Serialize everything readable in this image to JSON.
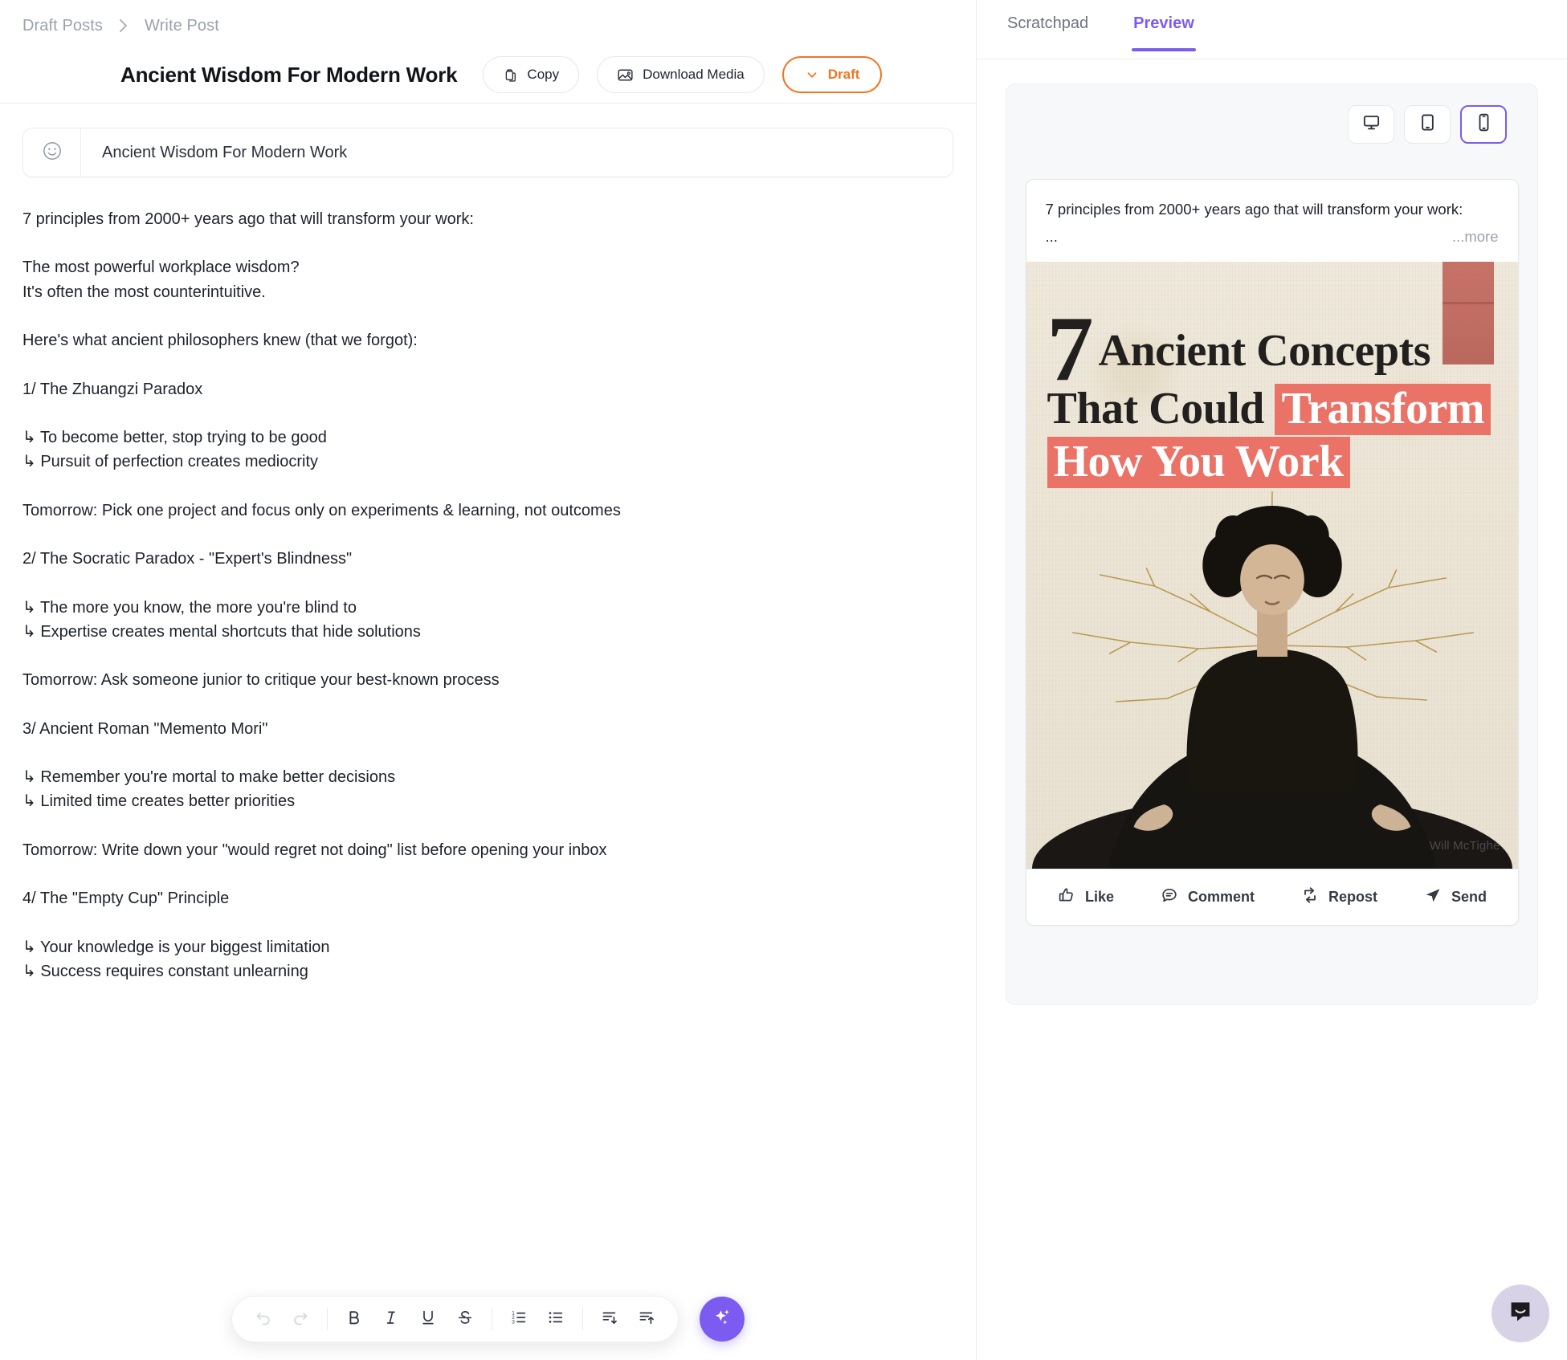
{
  "breadcrumb": {
    "parent": "Draft Posts",
    "current": "Write Post",
    "separator_icon": "chevron-right-icon"
  },
  "header": {
    "doc_title": "Ancient Wisdom For Modern Work",
    "copy_label": "Copy",
    "copy_icon": "clipboard-icon",
    "download_label": "Download Media",
    "download_icon": "image-icon",
    "draft_label": "Draft",
    "draft_icon": "chevron-down-icon",
    "draft_color": "#ef7622"
  },
  "title_field": {
    "emoji_icon": "smiley-icon",
    "value": "Ancient Wisdom For Modern Work",
    "placeholder": "Ancient Wisdom For Modern Work"
  },
  "post_body": {
    "paragraphs": [
      {
        "text": "7 principles from 2000+ years ago that will transform your work:",
        "style": "block"
      },
      {
        "text": "The most powerful workplace wisdom?",
        "style": "tight"
      },
      {
        "text": "It's often the most counterintuitive.",
        "style": "block"
      },
      {
        "text": "Here's what ancient philosophers knew (that we forgot):",
        "style": "block"
      },
      {
        "text": "1/ The Zhuangzi Paradox",
        "style": "block"
      },
      {
        "text": "↳ To become better, stop trying to be good",
        "style": "tight"
      },
      {
        "text": "↳ Pursuit of perfection creates mediocrity",
        "style": "block"
      },
      {
        "text": "Tomorrow: Pick one project and focus only on experiments & learning, not outcomes",
        "style": "block"
      },
      {
        "text": "2/ The Socratic Paradox - \"Expert's Blindness\"",
        "style": "block"
      },
      {
        "text": "↳ The more you know, the more you're blind to",
        "style": "tight"
      },
      {
        "text": "↳ Expertise creates mental shortcuts that hide solutions",
        "style": "block"
      },
      {
        "text": "Tomorrow: Ask someone junior to critique your best-known process",
        "style": "block"
      },
      {
        "text": "3/ Ancient Roman \"Memento Mori\"",
        "style": "block"
      },
      {
        "text": "↳ Remember you're mortal to make better decisions",
        "style": "tight"
      },
      {
        "text": "↳ Limited time creates better priorities",
        "style": "block"
      },
      {
        "text": "Tomorrow: Write down your \"would regret not doing\" list before opening your inbox",
        "style": "block"
      },
      {
        "text": "4/ The \"Empty Cup\" Principle",
        "style": "block"
      },
      {
        "text": "↳ Your knowledge is your biggest limitation",
        "style": "tight"
      },
      {
        "text": "↳ Success requires constant unlearning",
        "style": "block"
      }
    ]
  },
  "toolbar": {
    "buttons": [
      {
        "name": "undo-icon",
        "label": "Undo",
        "disabled": true
      },
      {
        "name": "redo-icon",
        "label": "Redo",
        "disabled": true
      },
      {
        "name": "bold-icon",
        "label": "B",
        "disabled": false
      },
      {
        "name": "italic-icon",
        "label": "I",
        "disabled": false
      },
      {
        "name": "underline-icon",
        "label": "U",
        "disabled": false
      },
      {
        "name": "strikethrough-icon",
        "label": "S",
        "disabled": false
      },
      {
        "name": "numbered-list-icon",
        "label": "Numbered list",
        "disabled": false
      },
      {
        "name": "bullet-list-icon",
        "label": "Bullet list",
        "disabled": false
      },
      {
        "name": "sort-descending-icon",
        "label": "Move down",
        "disabled": false
      },
      {
        "name": "sort-ascending-icon",
        "label": "Move up",
        "disabled": false
      }
    ],
    "ai_icon": "sparkle-icon",
    "ai_color": "#7c5cf0"
  },
  "preview": {
    "tabs": [
      {
        "label": "Scratchpad",
        "active": false
      },
      {
        "label": "Preview",
        "active": true
      }
    ],
    "accent_color": "#7c5cf0",
    "devices": [
      {
        "name": "desktop-icon",
        "label": "Desktop",
        "active": false
      },
      {
        "name": "tablet-icon",
        "label": "Tablet",
        "active": false
      },
      {
        "name": "mobile-icon",
        "label": "Mobile",
        "active": true
      }
    ],
    "card": {
      "text": "7 principles from 2000+ years ago that will transform your work:",
      "ellipsis": "...",
      "more_label": "...more",
      "image": {
        "headline_number": "7",
        "headline_line1": "Ancient Concepts",
        "headline_line2_plain": "That Could ",
        "headline_line2_highlight": "Transform",
        "headline_line3": "How You Work",
        "highlight_color": "#ea7266",
        "paper_color": "#ece5d6",
        "artist_credit": "Will McTighe",
        "tape_color": "#bd6359"
      },
      "actions": [
        {
          "label": "Like",
          "icon": "thumbs-up-icon"
        },
        {
          "label": "Comment",
          "icon": "comment-icon"
        },
        {
          "label": "Repost",
          "icon": "repost-icon"
        },
        {
          "label": "Send",
          "icon": "send-icon"
        }
      ]
    }
  },
  "launcher": {
    "icon": "chat-bubble-smile-icon"
  }
}
